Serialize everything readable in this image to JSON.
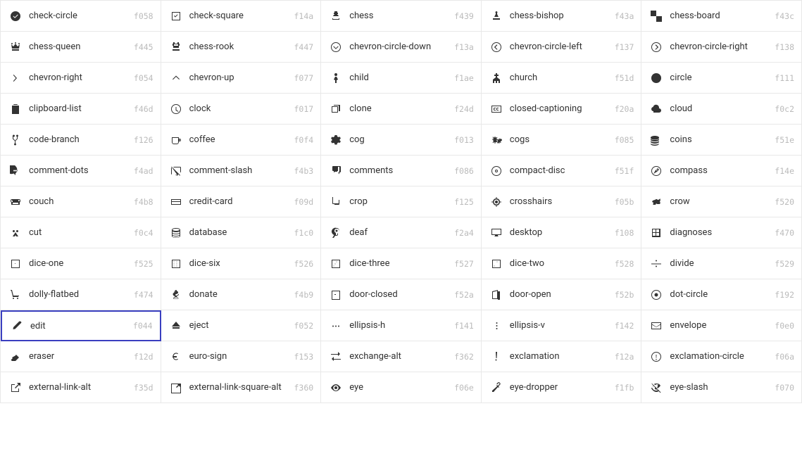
{
  "icons": [
    {
      "name": "check-circle",
      "code": "f058",
      "icon": "✔",
      "unicode": "●✓",
      "svg": "check-circle"
    },
    {
      "name": "check-square",
      "code": "f14a",
      "icon": "☑",
      "svg": "check-square"
    },
    {
      "name": "chess",
      "code": "f439",
      "icon": "♟",
      "svg": "chess"
    },
    {
      "name": "chess-bishop",
      "code": "f43a",
      "icon": "♝",
      "svg": "chess-bishop"
    },
    {
      "name": "chess-board",
      "code": "f43c",
      "icon": "⊞",
      "svg": "chess-board"
    },
    {
      "name": "chess-queen",
      "code": "f445",
      "icon": "♛",
      "svg": "chess-queen"
    },
    {
      "name": "chess-rook",
      "code": "f447",
      "icon": "♜",
      "svg": "chess-rook"
    },
    {
      "name": "chevron-circle-down",
      "code": "f13a",
      "icon": "⊙",
      "svg": "chevron-circle-down"
    },
    {
      "name": "chevron-circle-left",
      "code": "f137",
      "icon": "◀",
      "svg": "chevron-circle-left"
    },
    {
      "name": "chevron-circle-right",
      "code": "f138",
      "icon": "▶",
      "svg": "chevron-circle-right"
    },
    {
      "name": "chevron-right",
      "code": "f054",
      "icon": "›",
      "svg": "chevron-right"
    },
    {
      "name": "chevron-up",
      "code": "f077",
      "icon": "∧",
      "svg": "chevron-up"
    },
    {
      "name": "child",
      "code": "f1ae",
      "icon": "🧒",
      "svg": "child"
    },
    {
      "name": "church",
      "code": "f51d",
      "icon": "⛪",
      "svg": "church"
    },
    {
      "name": "circle",
      "code": "f111",
      "icon": "●",
      "svg": "circle"
    },
    {
      "name": "clipboard-list",
      "code": "f46d",
      "icon": "📋",
      "svg": "clipboard-list"
    },
    {
      "name": "clock",
      "code": "f017",
      "icon": "🕐",
      "svg": "clock"
    },
    {
      "name": "clone",
      "code": "f24d",
      "icon": "⧉",
      "svg": "clone"
    },
    {
      "name": "closed-captioning",
      "code": "f20a",
      "icon": "CC",
      "svg": "closed-captioning"
    },
    {
      "name": "cloud",
      "code": "f0c2",
      "icon": "☁",
      "svg": "cloud"
    },
    {
      "name": "code-branch",
      "code": "f126",
      "icon": "⑂",
      "svg": "code-branch"
    },
    {
      "name": "coffee",
      "code": "f0f4",
      "icon": "☕",
      "svg": "coffee"
    },
    {
      "name": "cog",
      "code": "f013",
      "icon": "⚙",
      "svg": "cog"
    },
    {
      "name": "cogs",
      "code": "f085",
      "icon": "⚙",
      "svg": "cogs"
    },
    {
      "name": "coins",
      "code": "f51e",
      "icon": "🪙",
      "svg": "coins"
    },
    {
      "name": "comment-dots",
      "code": "f4ad",
      "icon": "💬",
      "svg": "comment-dots"
    },
    {
      "name": "comment-slash",
      "code": "f4b3",
      "icon": "💬",
      "svg": "comment-slash"
    },
    {
      "name": "comments",
      "code": "f086",
      "icon": "💬",
      "svg": "comments"
    },
    {
      "name": "compact-disc",
      "code": "f51f",
      "icon": "💿",
      "svg": "compact-disc"
    },
    {
      "name": "compass",
      "code": "f14e",
      "icon": "🧭",
      "svg": "compass"
    },
    {
      "name": "couch",
      "code": "f4b8",
      "icon": "🛋",
      "svg": "couch"
    },
    {
      "name": "credit-card",
      "code": "f09d",
      "icon": "💳",
      "svg": "credit-card"
    },
    {
      "name": "crop",
      "code": "f125",
      "icon": "✂",
      "svg": "crop"
    },
    {
      "name": "crosshairs",
      "code": "f05b",
      "icon": "⊕",
      "svg": "crosshairs"
    },
    {
      "name": "crow",
      "code": "f520",
      "icon": "🐦",
      "svg": "crow"
    },
    {
      "name": "cut",
      "code": "f0c4",
      "icon": "✂",
      "svg": "cut"
    },
    {
      "name": "database",
      "code": "f1c0",
      "icon": "🗄",
      "svg": "database"
    },
    {
      "name": "deaf",
      "code": "f2a4",
      "icon": "🦻",
      "svg": "deaf"
    },
    {
      "name": "desktop",
      "code": "f108",
      "icon": "🖥",
      "svg": "desktop"
    },
    {
      "name": "diagnoses",
      "code": "f470",
      "icon": "⊕",
      "svg": "diagnoses"
    },
    {
      "name": "dice-one",
      "code": "f525",
      "icon": "⚀",
      "svg": "dice-one"
    },
    {
      "name": "dice-six",
      "code": "f526",
      "icon": "⚅",
      "svg": "dice-six"
    },
    {
      "name": "dice-three",
      "code": "f527",
      "icon": "⚂",
      "svg": "dice-three"
    },
    {
      "name": "dice-two",
      "code": "f528",
      "icon": "⚁",
      "svg": "dice-two"
    },
    {
      "name": "divide",
      "code": "f529",
      "icon": "÷",
      "svg": "divide"
    },
    {
      "name": "dolly-flatbed",
      "code": "f474",
      "icon": "🛒",
      "svg": "dolly-flatbed"
    },
    {
      "name": "donate",
      "code": "f4b9",
      "icon": "$",
      "svg": "donate"
    },
    {
      "name": "door-closed",
      "code": "f52a",
      "icon": "🚪",
      "svg": "door-closed"
    },
    {
      "name": "door-open",
      "code": "f52b",
      "icon": "🚪",
      "svg": "door-open"
    },
    {
      "name": "dot-circle",
      "code": "f192",
      "icon": "◎",
      "svg": "dot-circle"
    },
    {
      "name": "edit",
      "code": "f044",
      "icon": "✏",
      "svg": "edit",
      "highlighted": true
    },
    {
      "name": "eject",
      "code": "f052",
      "icon": "⏏",
      "svg": "eject"
    },
    {
      "name": "ellipsis-h",
      "code": "f141",
      "icon": "···",
      "svg": "ellipsis-h"
    },
    {
      "name": "ellipsis-v",
      "code": "f142",
      "icon": "⋮",
      "svg": "ellipsis-v"
    },
    {
      "name": "envelope",
      "code": "f0e0",
      "icon": "✉",
      "svg": "envelope"
    },
    {
      "name": "eraser",
      "code": "f12d",
      "icon": "⌦",
      "svg": "eraser"
    },
    {
      "name": "euro-sign",
      "code": "f153",
      "icon": "€",
      "svg": "euro-sign"
    },
    {
      "name": "exchange-alt",
      "code": "f362",
      "icon": "⇄",
      "svg": "exchange-alt"
    },
    {
      "name": "exclamation",
      "code": "f12a",
      "icon": "!",
      "svg": "exclamation"
    },
    {
      "name": "exclamation-circle",
      "code": "f06a",
      "icon": "⊙",
      "svg": "exclamation-circle"
    },
    {
      "name": "external-link-alt",
      "code": "f35d",
      "icon": "↗",
      "svg": "external-link-alt"
    },
    {
      "name": "external-link-square-alt",
      "code": "f360",
      "icon": "↗",
      "svg": "external-link-square-alt"
    },
    {
      "name": "eye",
      "code": "f06e",
      "icon": "👁",
      "svg": "eye"
    },
    {
      "name": "eye-dropper",
      "code": "f1fb",
      "icon": "💧",
      "svg": "eye-dropper"
    },
    {
      "name": "eye-slash",
      "code": "f070",
      "icon": "👁",
      "svg": "eye-slash"
    }
  ],
  "cols": 5
}
